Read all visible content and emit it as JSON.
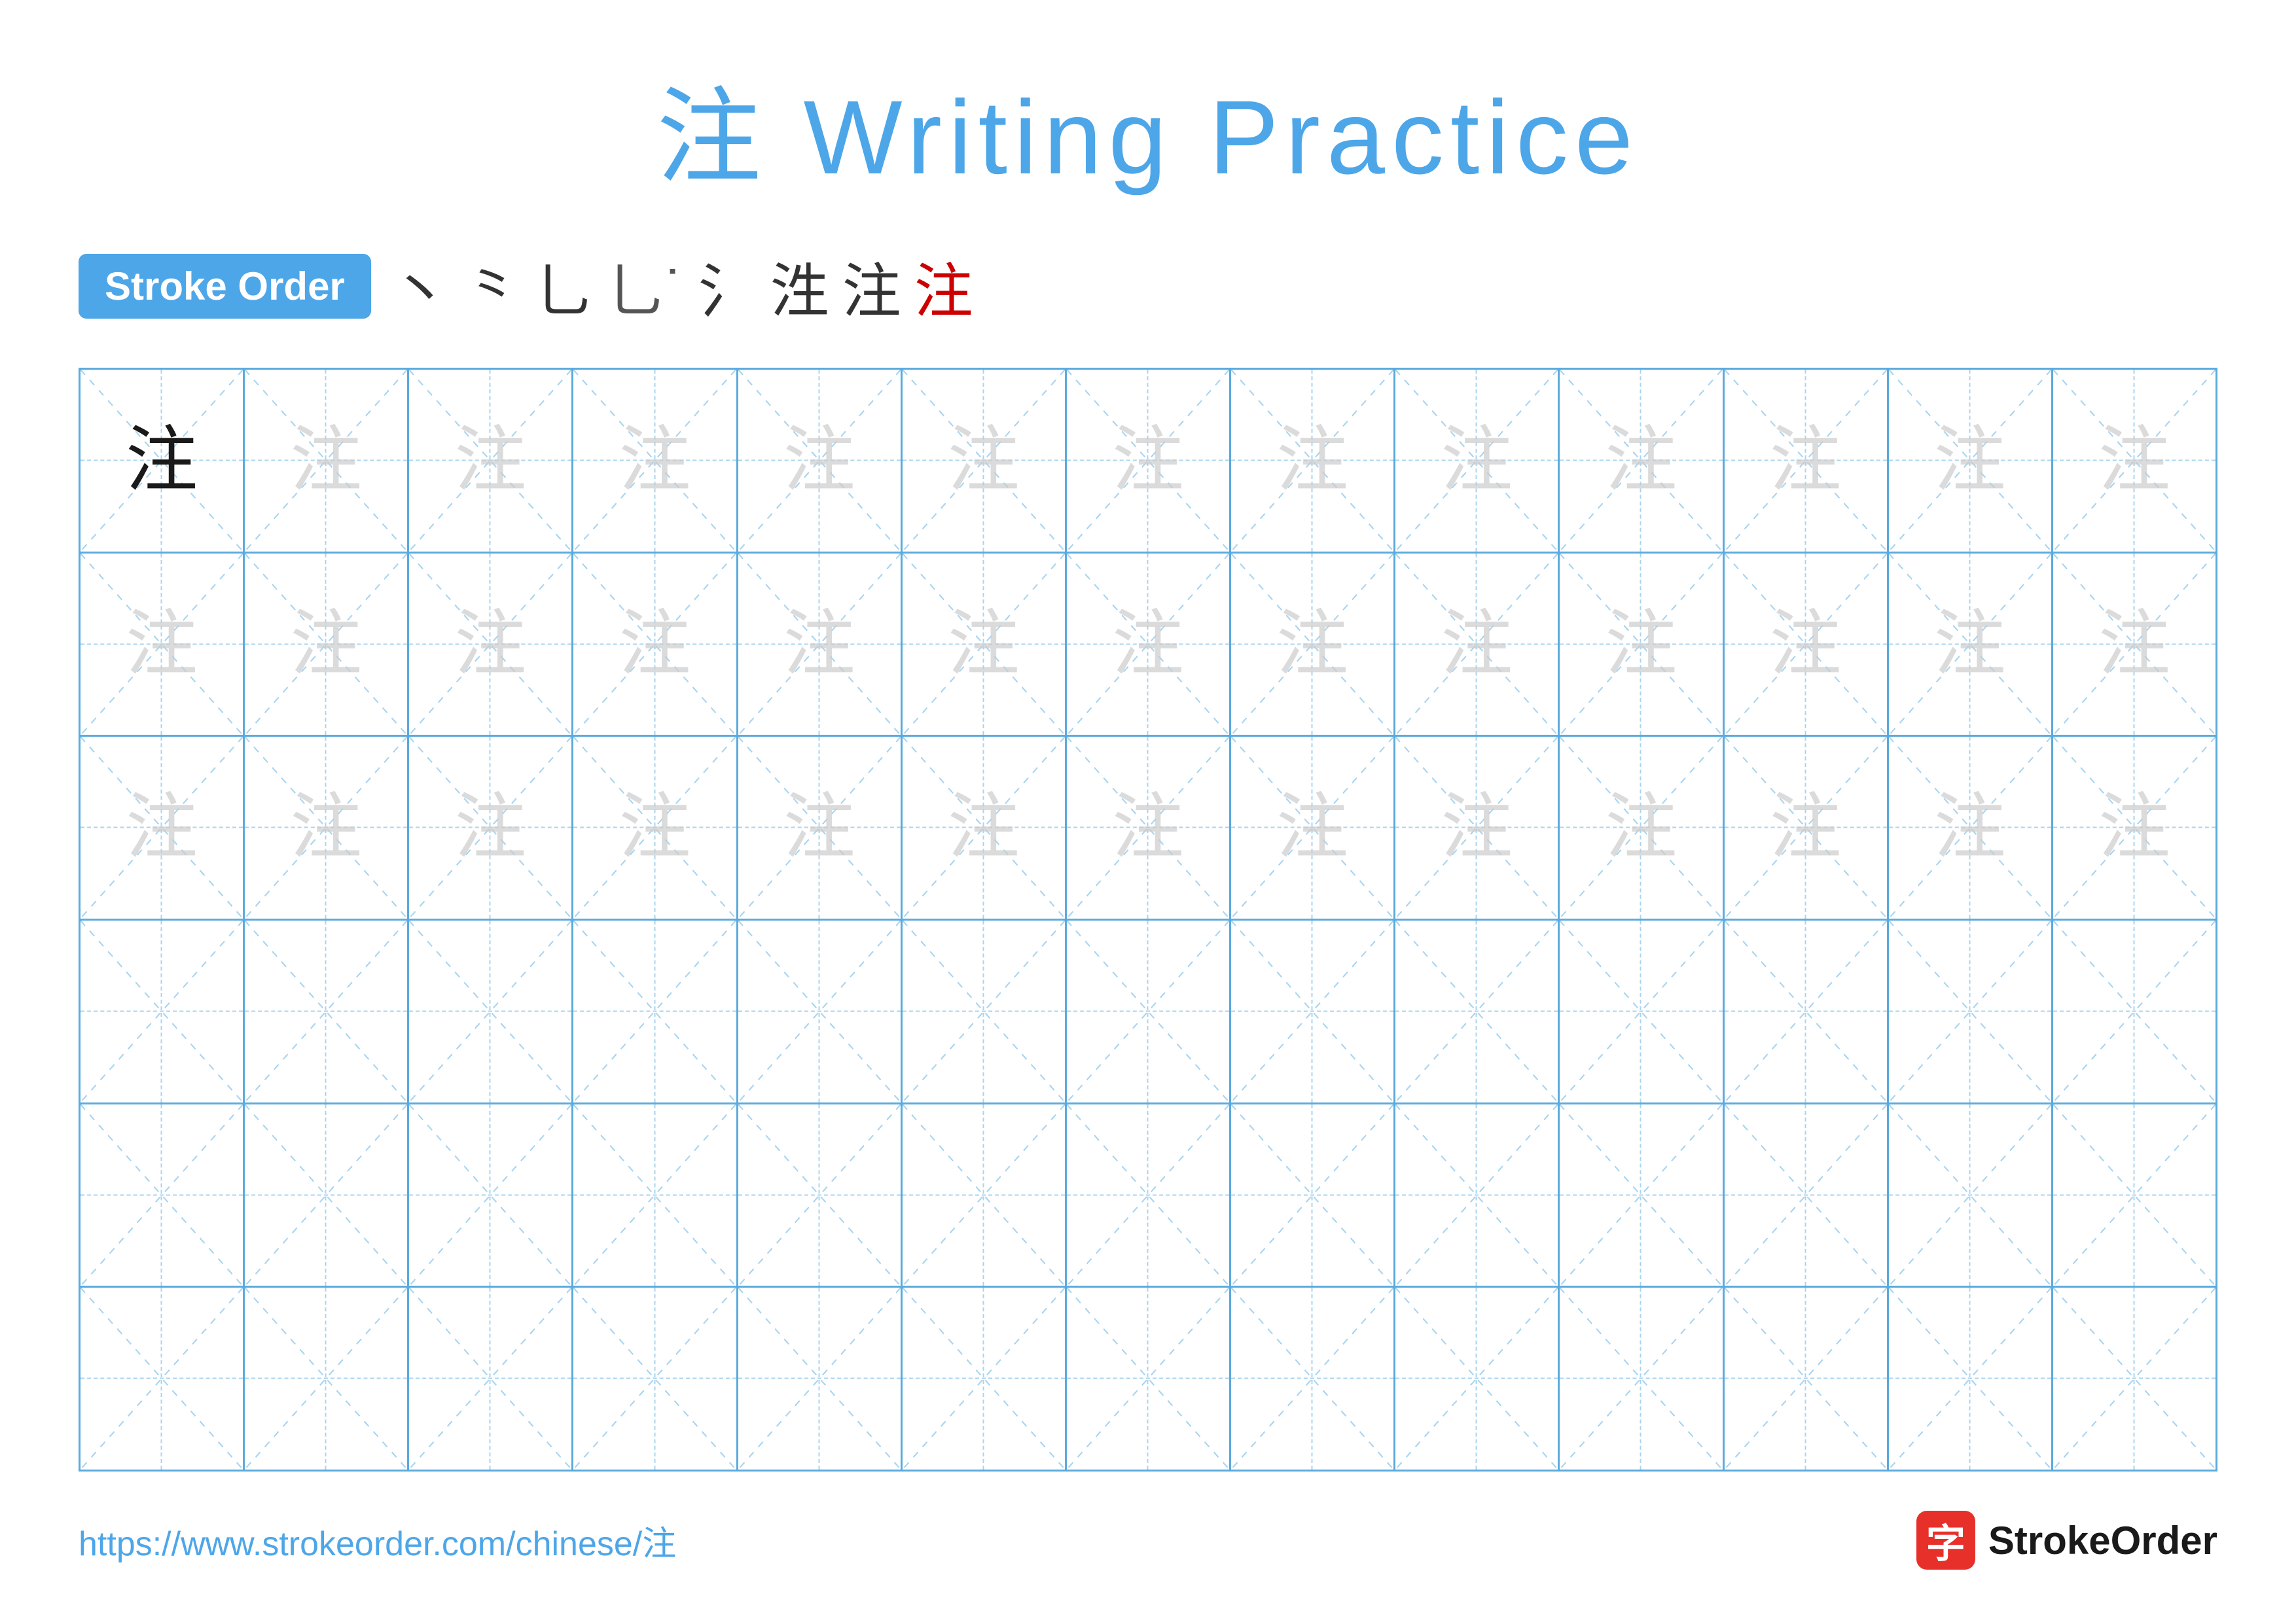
{
  "title": {
    "chinese_char": "注",
    "text": "Writing Practice",
    "full": "注 Writing Practice"
  },
  "stroke_order": {
    "badge_label": "Stroke Order",
    "steps": [
      "丶",
      "丶",
      "⺃",
      "⺃",
      "氵",
      "注̣",
      "注̈",
      "注"
    ],
    "steps_display": [
      "丶",
      "⺀",
      "⺃",
      "⺄",
      "氵",
      "氵⺀",
      "注̃",
      "注"
    ]
  },
  "grid": {
    "rows": 6,
    "cols": 13,
    "character": "注",
    "row_types": [
      "dark_then_light",
      "light",
      "light",
      "empty",
      "empty",
      "empty"
    ]
  },
  "footer": {
    "url": "https://www.strokeorder.com/chinese/注",
    "brand_name": "StrokeOrder",
    "logo_char": "字"
  },
  "colors": {
    "blue": "#4da6e8",
    "red": "#cc0000",
    "grid_border": "#5aaadd",
    "grid_guide": "#a8d4f0",
    "char_dark": "#1a1a1a",
    "char_light": "#cccccc",
    "badge_bg": "#4da6e8",
    "logo_bg": "#e8302a"
  }
}
